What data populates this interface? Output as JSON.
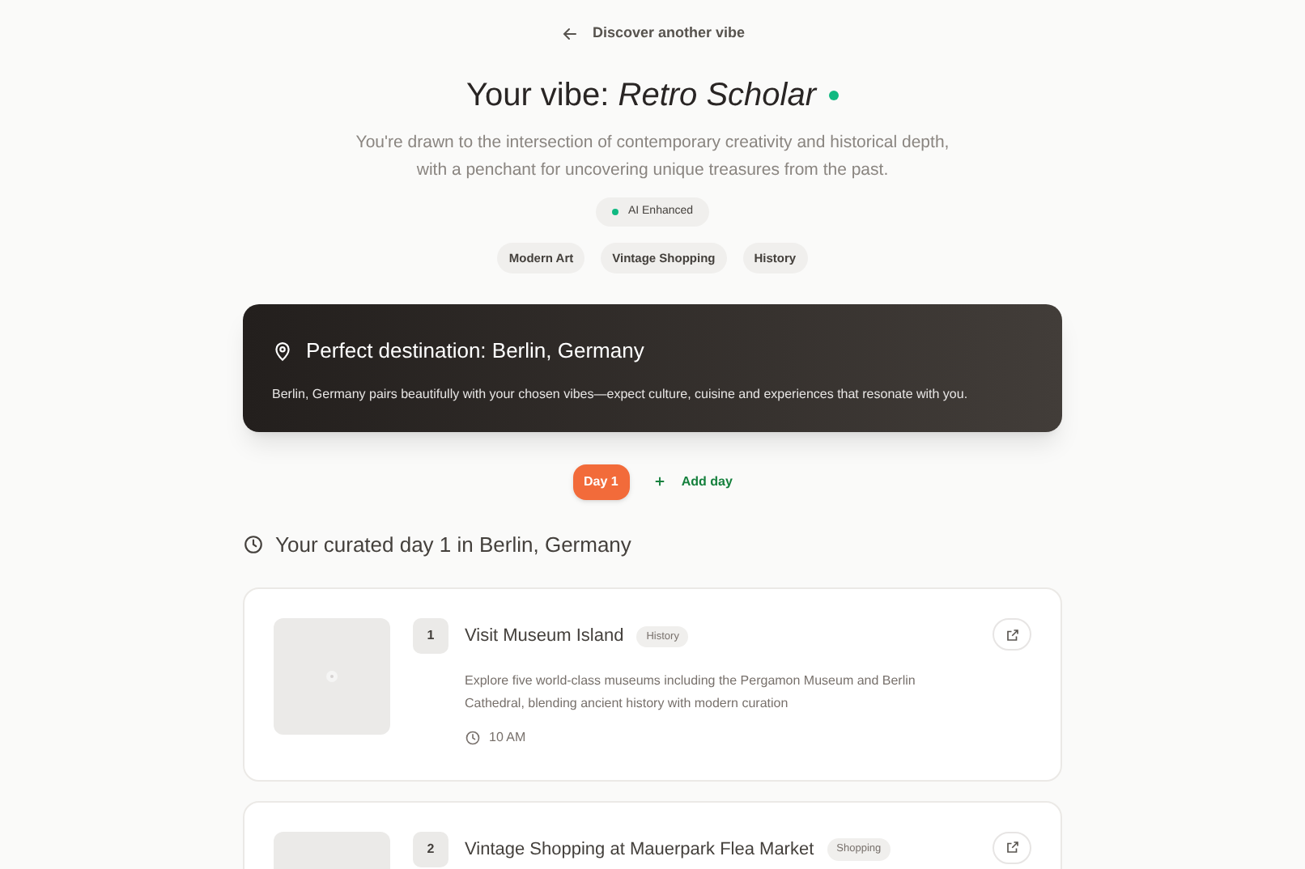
{
  "back_link": "Discover another vibe",
  "heading": {
    "prefix": "Your vibe:",
    "vibe": "Retro Scholar"
  },
  "description": "You're drawn to the intersection of contemporary creativity and historical depth, with a penchant for uncovering unique treasures from the past.",
  "badge": {
    "label": "AI Enhanced"
  },
  "tags": [
    "Modern Art",
    "Vintage Shopping",
    "History"
  ],
  "destination": {
    "title": "Perfect destination: Berlin, Germany",
    "text": "Berlin, Germany pairs beautifully with your chosen vibes—expect culture, cuisine and experiences that resonate with you."
  },
  "days": [
    {
      "label": "Day 1",
      "selected": true
    }
  ],
  "add_day": "Add day",
  "section_title": "Your curated day 1 in Berlin, Germany",
  "activities": [
    {
      "number": "1",
      "title": "Visit Museum Island",
      "tag": "History",
      "description": "Explore five world-class museums including the Pergamon Museum and Berlin Cathedral, blending ancient history with modern curation",
      "time": "10 AM"
    },
    {
      "number": "2",
      "title": "Vintage Shopping at Mauerpark Flea Market",
      "tag": "Shopping"
    }
  ]
}
